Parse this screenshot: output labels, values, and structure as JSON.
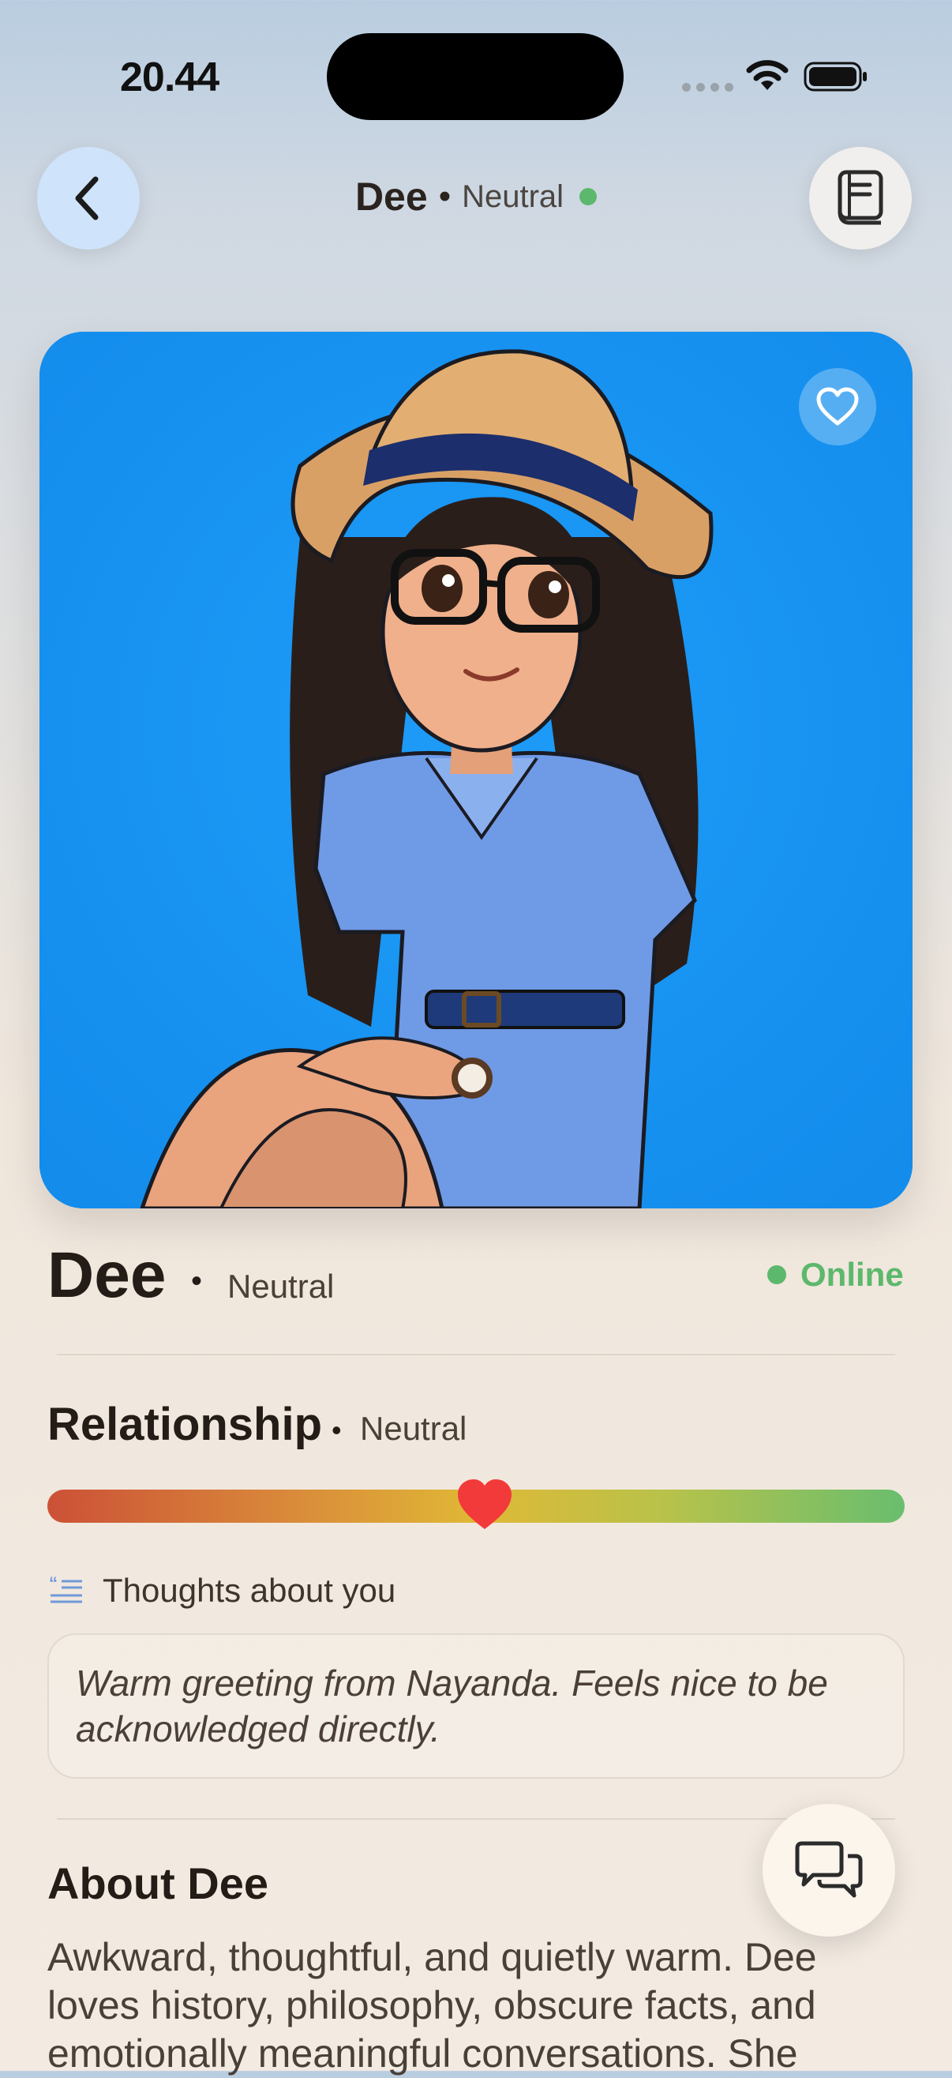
{
  "status_bar": {
    "time": "20.44"
  },
  "header": {
    "name": "Dee",
    "separator": "•",
    "mood": "Neutral"
  },
  "profile": {
    "name": "Dee",
    "separator": "•",
    "mood": "Neutral",
    "status": "Online"
  },
  "relationship": {
    "title": "Relationship",
    "separator": "•",
    "level_label": "Neutral",
    "level_fraction": 0.51
  },
  "thoughts": {
    "label": "Thoughts about you",
    "text": "Warm greeting from Nayanda. Feels nice to be acknowledged directly."
  },
  "about": {
    "title": "About Dee",
    "text": "Awkward, thoughtful, and quietly warm. Dee loves history, philosophy, obscure facts, and emotionally meaningful conversations. She"
  },
  "colors": {
    "accent_online": "#5cb86c",
    "avatar_bg": "#1996f4",
    "heart": "#f23a3a"
  },
  "icons": {
    "back": "chevron-left-icon",
    "journal": "book-icon",
    "favorite": "heart-outline-icon",
    "thoughts": "quote-lines-icon",
    "chat": "chat-bubbles-icon"
  }
}
